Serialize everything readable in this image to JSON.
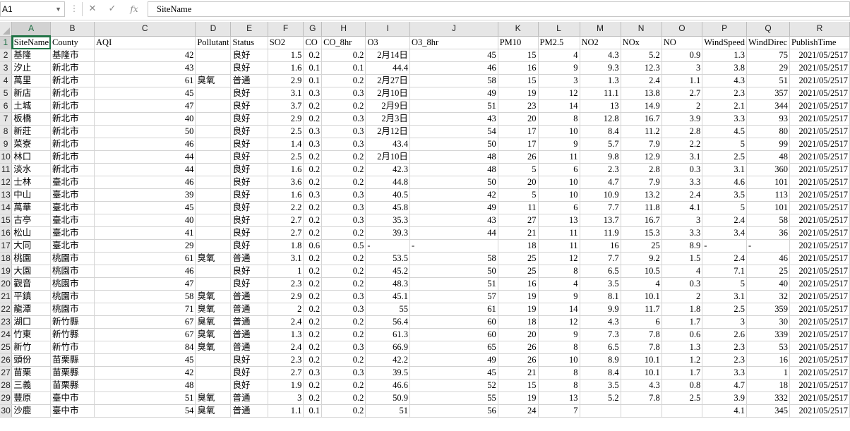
{
  "formula_bar": {
    "name_box": "A1",
    "value": "SiteName"
  },
  "columns": [
    "A",
    "B",
    "C",
    "D",
    "E",
    "F",
    "G",
    "H",
    "I",
    "J",
    "K",
    "L",
    "M",
    "N",
    "O",
    "P",
    "Q",
    "R"
  ],
  "active_cell": "A1",
  "row_numbers": [
    "1",
    "2",
    "3",
    "4",
    "5",
    "6",
    "7",
    "8",
    "9",
    "10",
    "11",
    "12",
    "13",
    "14",
    "15",
    "16",
    "17",
    "18",
    "19",
    "20",
    "21",
    "22",
    "23",
    "24",
    "25",
    "26",
    "27",
    "28",
    "29",
    "30"
  ],
  "rows": [
    [
      "SiteName",
      "County",
      "AQI",
      "Pollutant",
      "Status",
      "SO2",
      "CO",
      "CO_8hr",
      "O3",
      "O3_8hr",
      "PM10",
      "PM2.5",
      "NO2",
      "NOx",
      "NO",
      "WindSpeed",
      "WindDirec",
      "PublishTime"
    ],
    [
      "基隆",
      "基隆市",
      "42",
      "",
      "良好",
      "1.5",
      "0.2",
      "0.2",
      "2月14日",
      "45",
      "15",
      "4",
      "4.3",
      "5.2",
      "0.9",
      "1.3",
      "75",
      "2021/05/2517"
    ],
    [
      "汐止",
      "新北市",
      "43",
      "",
      "良好",
      "1.6",
      "0.1",
      "0.1",
      "44.4",
      "46",
      "16",
      "9",
      "9.3",
      "12.3",
      "3",
      "3.8",
      "29",
      "2021/05/2517"
    ],
    [
      "萬里",
      "新北市",
      "61",
      "臭氧",
      "普通",
      "2.9",
      "0.1",
      "0.2",
      "2月27日",
      "58",
      "15",
      "3",
      "1.3",
      "2.4",
      "1.1",
      "4.3",
      "51",
      "2021/05/2517"
    ],
    [
      "新店",
      "新北市",
      "45",
      "",
      "良好",
      "3.1",
      "0.3",
      "0.3",
      "2月10日",
      "49",
      "19",
      "12",
      "11.1",
      "13.8",
      "2.7",
      "2.3",
      "357",
      "2021/05/2517"
    ],
    [
      "土城",
      "新北市",
      "47",
      "",
      "良好",
      "3.7",
      "0.2",
      "0.2",
      "2月9日",
      "51",
      "23",
      "14",
      "13",
      "14.9",
      "2",
      "2.1",
      "344",
      "2021/05/2517"
    ],
    [
      "板橋",
      "新北市",
      "40",
      "",
      "良好",
      "2.9",
      "0.2",
      "0.3",
      "2月3日",
      "43",
      "20",
      "8",
      "12.8",
      "16.7",
      "3.9",
      "3.3",
      "93",
      "2021/05/2517"
    ],
    [
      "新莊",
      "新北市",
      "50",
      "",
      "良好",
      "2.5",
      "0.3",
      "0.3",
      "2月12日",
      "54",
      "17",
      "10",
      "8.4",
      "11.2",
      "2.8",
      "4.5",
      "80",
      "2021/05/2517"
    ],
    [
      "菜寮",
      "新北市",
      "46",
      "",
      "良好",
      "1.4",
      "0.3",
      "0.3",
      "43.4",
      "50",
      "17",
      "9",
      "5.7",
      "7.9",
      "2.2",
      "5",
      "99",
      "2021/05/2517"
    ],
    [
      "林口",
      "新北市",
      "44",
      "",
      "良好",
      "2.5",
      "0.2",
      "0.2",
      "2月10日",
      "48",
      "26",
      "11",
      "9.8",
      "12.9",
      "3.1",
      "2.5",
      "48",
      "2021/05/2517"
    ],
    [
      "淡水",
      "新北市",
      "44",
      "",
      "良好",
      "1.6",
      "0.2",
      "0.2",
      "42.3",
      "48",
      "5",
      "6",
      "2.3",
      "2.8",
      "0.3",
      "3.1",
      "360",
      "2021/05/2517"
    ],
    [
      "士林",
      "臺北市",
      "46",
      "",
      "良好",
      "3.6",
      "0.2",
      "0.2",
      "44.8",
      "50",
      "20",
      "10",
      "4.7",
      "7.9",
      "3.3",
      "4.6",
      "101",
      "2021/05/2517"
    ],
    [
      "中山",
      "臺北市",
      "39",
      "",
      "良好",
      "1.6",
      "0.3",
      "0.3",
      "40.5",
      "42",
      "5",
      "10",
      "10.9",
      "13.2",
      "2.4",
      "3.5",
      "113",
      "2021/05/2517"
    ],
    [
      "萬華",
      "臺北市",
      "45",
      "",
      "良好",
      "2.2",
      "0.2",
      "0.3",
      "45.8",
      "49",
      "11",
      "6",
      "7.7",
      "11.8",
      "4.1",
      "5",
      "101",
      "2021/05/2517"
    ],
    [
      "古亭",
      "臺北市",
      "40",
      "",
      "良好",
      "2.7",
      "0.2",
      "0.3",
      "35.3",
      "43",
      "27",
      "13",
      "13.7",
      "16.7",
      "3",
      "2.4",
      "58",
      "2021/05/2517"
    ],
    [
      "松山",
      "臺北市",
      "41",
      "",
      "良好",
      "2.7",
      "0.2",
      "0.2",
      "39.3",
      "44",
      "21",
      "11",
      "11.9",
      "15.3",
      "3.3",
      "3.4",
      "36",
      "2021/05/2517"
    ],
    [
      "大同",
      "臺北市",
      "29",
      "",
      "良好",
      "1.8",
      "0.6",
      "0.5",
      "-",
      "-",
      "18",
      "11",
      "16",
      "25",
      "8.9",
      "-",
      "-",
      "2021/05/2517"
    ],
    [
      "桃園",
      "桃園市",
      "61",
      "臭氧",
      "普通",
      "3.1",
      "0.2",
      "0.2",
      "53.5",
      "58",
      "25",
      "12",
      "7.7",
      "9.2",
      "1.5",
      "2.4",
      "46",
      "2021/05/2517"
    ],
    [
      "大園",
      "桃園市",
      "46",
      "",
      "良好",
      "1",
      "0.2",
      "0.2",
      "45.2",
      "50",
      "25",
      "8",
      "6.5",
      "10.5",
      "4",
      "7.1",
      "25",
      "2021/05/2517"
    ],
    [
      "觀音",
      "桃園市",
      "47",
      "",
      "良好",
      "2.3",
      "0.2",
      "0.2",
      "48.3",
      "51",
      "16",
      "4",
      "3.5",
      "4",
      "0.3",
      "5",
      "40",
      "2021/05/2517"
    ],
    [
      "平鎮",
      "桃園市",
      "58",
      "臭氧",
      "普通",
      "2.9",
      "0.2",
      "0.3",
      "45.1",
      "57",
      "19",
      "9",
      "8.1",
      "10.1",
      "2",
      "3.1",
      "32",
      "2021/05/2517"
    ],
    [
      "龍潭",
      "桃園市",
      "71",
      "臭氧",
      "普通",
      "2",
      "0.2",
      "0.3",
      "55",
      "61",
      "19",
      "14",
      "9.9",
      "11.7",
      "1.8",
      "2.5",
      "359",
      "2021/05/2517"
    ],
    [
      "湖口",
      "新竹縣",
      "67",
      "臭氧",
      "普通",
      "2.4",
      "0.2",
      "0.2",
      "56.4",
      "60",
      "18",
      "12",
      "4.3",
      "6",
      "1.7",
      "3",
      "30",
      "2021/05/2517"
    ],
    [
      "竹東",
      "新竹縣",
      "67",
      "臭氧",
      "普通",
      "1.3",
      "0.2",
      "0.2",
      "61.3",
      "60",
      "20",
      "9",
      "7.3",
      "7.8",
      "0.6",
      "2.6",
      "339",
      "2021/05/2517"
    ],
    [
      "新竹",
      "新竹市",
      "84",
      "臭氧",
      "普通",
      "2.4",
      "0.2",
      "0.3",
      "66.9",
      "65",
      "26",
      "8",
      "6.5",
      "7.8",
      "1.3",
      "2.3",
      "53",
      "2021/05/2517"
    ],
    [
      "頭份",
      "苗栗縣",
      "45",
      "",
      "良好",
      "2.3",
      "0.2",
      "0.2",
      "42.2",
      "49",
      "26",
      "10",
      "8.9",
      "10.1",
      "1.2",
      "2.3",
      "16",
      "2021/05/2517"
    ],
    [
      "苗栗",
      "苗栗縣",
      "42",
      "",
      "良好",
      "2.7",
      "0.3",
      "0.3",
      "39.5",
      "45",
      "21",
      "8",
      "8.4",
      "10.1",
      "1.7",
      "3.3",
      "1",
      "2021/05/2517"
    ],
    [
      "三義",
      "苗栗縣",
      "48",
      "",
      "良好",
      "1.9",
      "0.2",
      "0.2",
      "46.6",
      "52",
      "15",
      "8",
      "3.5",
      "4.3",
      "0.8",
      "4.7",
      "18",
      "2021/05/2517"
    ],
    [
      "豐原",
      "臺中市",
      "51",
      "臭氧",
      "普通",
      "3",
      "0.2",
      "0.2",
      "50.9",
      "55",
      "19",
      "13",
      "5.2",
      "7.8",
      "2.5",
      "3.9",
      "332",
      "2021/05/2517"
    ],
    [
      "沙鹿",
      "臺中市",
      "54",
      "臭氧",
      "普通",
      "1.1",
      "0.1",
      "0.2",
      "51",
      "56",
      "24",
      "7",
      "",
      "",
      "",
      "4.1",
      "345",
      "2021/05/2517"
    ]
  ]
}
